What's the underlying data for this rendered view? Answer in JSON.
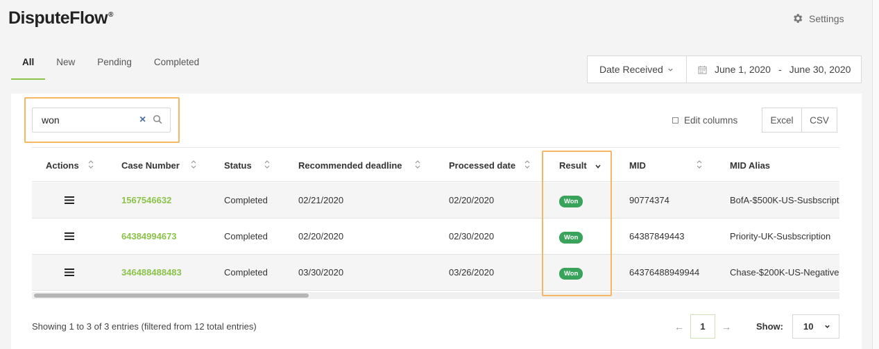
{
  "app": {
    "name": "DisputeFlow",
    "mark": "®"
  },
  "header": {
    "settings_label": "Settings"
  },
  "tabs": [
    {
      "label": "All",
      "active": true
    },
    {
      "label": "New",
      "active": false
    },
    {
      "label": "Pending",
      "active": false
    },
    {
      "label": "Completed",
      "active": false
    }
  ],
  "date_filter": {
    "type": "Date Received",
    "start": "June 1, 2020",
    "separator": "-",
    "end": "June 30, 2020"
  },
  "search": {
    "value": "won"
  },
  "toolbar": {
    "edit_columns": "Edit columns",
    "excel": "Excel",
    "csv": "CSV"
  },
  "table": {
    "columns": [
      "Actions",
      "Case Number",
      "Status",
      "Recommended deadline",
      "Processed date",
      "Result",
      "MID",
      "MID Alias"
    ],
    "rows": [
      {
        "case": "1567546632",
        "status": "Completed",
        "deadline": "02/21/2020",
        "processed": "02/20/2020",
        "result": "Won",
        "mid": "90774374",
        "alias": "BofA-$500K-US-Susbscript"
      },
      {
        "case": "64384994673",
        "status": "Completed",
        "deadline": "02/20/2020",
        "processed": "02/30/2020",
        "result": "Won",
        "mid": "64387849443",
        "alias": "Priority-UK-Susbscription"
      },
      {
        "case": "346488488483",
        "status": "Completed",
        "deadline": "03/30/2020",
        "processed": "03/26/2020",
        "result": "Won",
        "mid": "64376488949944",
        "alias": "Chase-$200K-US-Negative"
      }
    ]
  },
  "footer": {
    "info": "Showing 1 to 3 of 3 entries (filtered from 12 total entries)",
    "page": "1",
    "prev": "←",
    "next": "→",
    "show_label": "Show:",
    "show_value": "10"
  },
  "colors": {
    "accent": "#8bc34a",
    "badge": "#3aa35b",
    "highlight": "#f5b764"
  }
}
